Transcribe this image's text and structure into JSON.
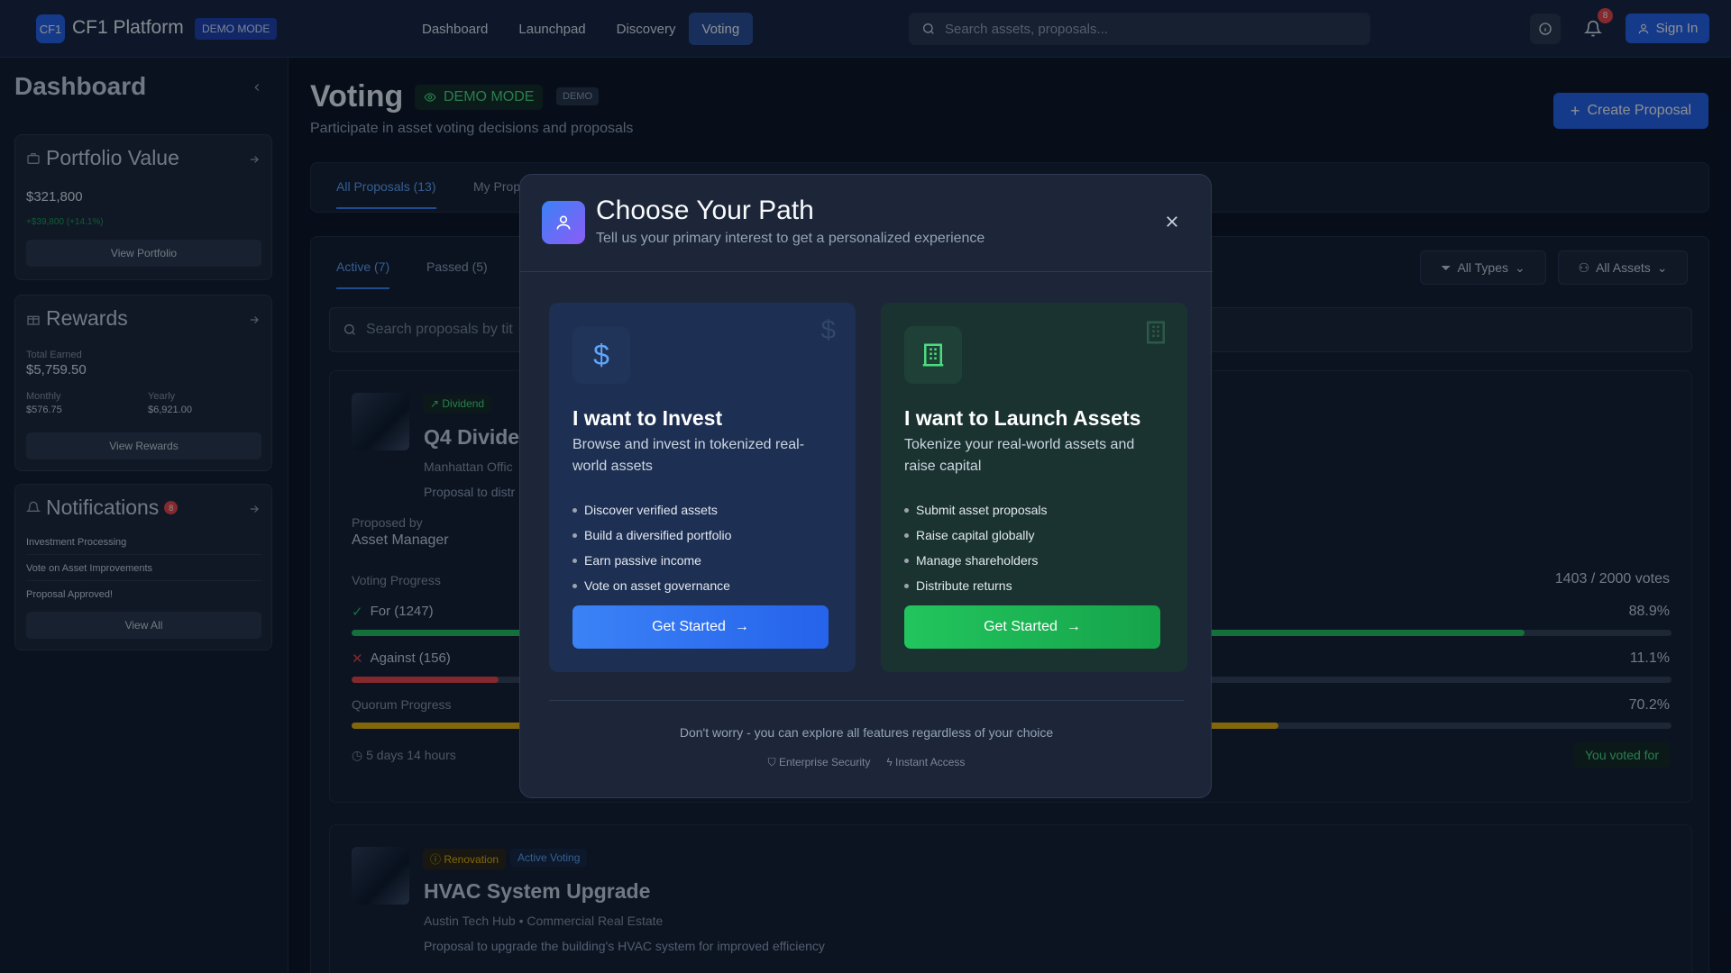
{
  "header": {
    "logo": "CF1",
    "brand": "CF1 Platform",
    "demo_badge": "DEMO MODE",
    "nav": [
      "Dashboard",
      "Launchpad",
      "Discovery",
      "Voting"
    ],
    "search_placeholder": "Search assets, proposals...",
    "notif_count": "8",
    "signin": "Sign In"
  },
  "sidebar": {
    "title": "Dashboard",
    "portfolio": {
      "title": "Portfolio Value",
      "value": "$321,800",
      "change": "+$39,800 (+14.1%)",
      "button": "View Portfolio"
    },
    "rewards": {
      "title": "Rewards",
      "total_label": "Total Earned",
      "total": "$5,759.50",
      "monthly_label": "Monthly",
      "monthly": "$576.75",
      "yearly_label": "Yearly",
      "yearly": "$6,921.00",
      "button": "View Rewards"
    },
    "notifications": {
      "title": "Notifications",
      "count": "8",
      "items": [
        "Investment Processing",
        "Vote on Asset Improvements",
        "Proposal Approved!"
      ],
      "button": "View All"
    }
  },
  "page": {
    "title": "Voting",
    "demo_mode": "DEMO MODE",
    "demo_tag": "DEMO",
    "subtitle": "Participate in asset voting decisions and proposals",
    "create_btn": "Create Proposal",
    "tabs": [
      "All Proposals (13)",
      "My Prop"
    ],
    "subtabs": [
      "Active (7)",
      "Passed (5)"
    ],
    "filter_types": "All Types",
    "filter_assets": "All Assets",
    "search_placeholder": "Search proposals by tit",
    "proposal1": {
      "tag": "Dividend",
      "title": "Q4 Divide",
      "asset": "Manhattan Offic",
      "desc": "Proposal to distr",
      "proposed_by_label": "Proposed by",
      "proposed_by": "Asset Manager",
      "progress_label": "Voting Progress",
      "votes": "1403 / 2000 votes",
      "for": "For (1247)",
      "for_pct": "88.9%",
      "against": "Against (156)",
      "against_pct": "11.1%",
      "quorum": "Quorum Progress",
      "quorum_pct": "70.2%",
      "time": "5 days 14 hours",
      "voted": "You voted for"
    },
    "proposal2": {
      "tag": "Renovation",
      "status": "Active Voting",
      "title": "HVAC System Upgrade",
      "asset": "Austin Tech Hub • Commercial Real Estate",
      "desc": "Proposal to upgrade the building's HVAC system for improved efficiency"
    }
  },
  "modal": {
    "title": "Choose Your Path",
    "subtitle": "Tell us your primary interest to get a personalized experience",
    "invest": {
      "title": "I want to Invest",
      "desc": "Browse and invest in tokenized real-world assets",
      "items": [
        "Discover verified assets",
        "Build a diversified portfolio",
        "Earn passive income",
        "Vote on asset governance"
      ],
      "button": "Get Started"
    },
    "launch": {
      "title": "I want to Launch Assets",
      "desc": "Tokenize your real-world assets and raise capital",
      "items": [
        "Submit asset proposals",
        "Raise capital globally",
        "Manage shareholders",
        "Distribute returns"
      ],
      "button": "Get Started"
    },
    "footer": "Don't worry - you can explore all features regardless of your choice",
    "security": "Enterprise Security",
    "access": "Instant Access"
  },
  "colors": {
    "accent": "#2563eb",
    "success": "#22c55e",
    "danger": "#ef4444",
    "quorum": "#eab308",
    "purple": "#8b5cf6"
  }
}
